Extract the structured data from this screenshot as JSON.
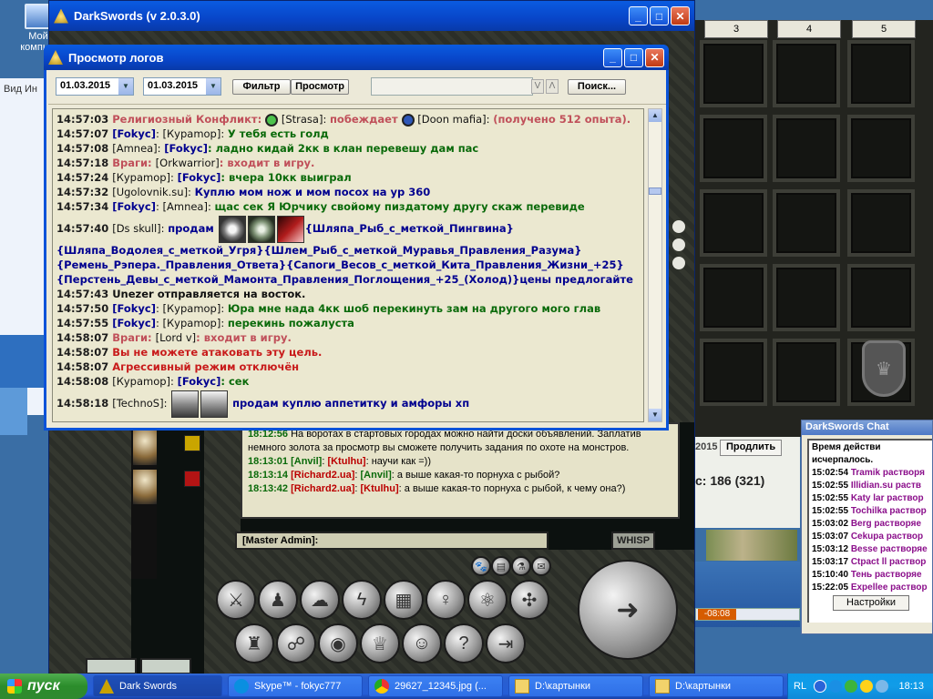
{
  "desktop": {
    "icon_label": "Мой компь...",
    "browser_menu": "Вид  Ин"
  },
  "game": {
    "title": "DarkSwords (v 2.0.3.0)",
    "chat_lines": [
      {
        "time": "18:12:56",
        "parts": [
          {
            "c": "t",
            "x": "На воротах в стартовых городах можно найти доски объявлений. Заплатив немного золота за просмотр вы сможете получить задания по охоте на монстров."
          }
        ]
      },
      {
        "time": "18:13:01",
        "parts": [
          {
            "c": "g",
            "x": "[Anvil]"
          },
          {
            "c": "t",
            "x": ": "
          },
          {
            "c": "r",
            "x": "[Ktulhu]"
          },
          {
            "c": "t",
            "x": ": научи как =))"
          }
        ]
      },
      {
        "time": "18:13:14",
        "parts": [
          {
            "c": "r",
            "x": "[Richard2.ua]"
          },
          {
            "c": "t",
            "x": ": "
          },
          {
            "c": "g",
            "x": "[Anvil]"
          },
          {
            "c": "t",
            "x": ": а выше какая-то порнуха с рыбой?"
          }
        ]
      },
      {
        "time": "18:13:42",
        "parts": [
          {
            "c": "r",
            "x": "[Richard2.ua]"
          },
          {
            "c": "t",
            "x": ": "
          },
          {
            "c": "r",
            "x": "[Ktulhu]"
          },
          {
            "c": "t",
            "x": ": а выше какая-то порнуха с рыбой, к чему она?)"
          }
        ]
      }
    ],
    "input_name": "[Master Admin]:",
    "whisp_label": "WHISP"
  },
  "inventory": {
    "headers": [
      "3",
      "4",
      "5"
    ],
    "year_fragment": "2015",
    "prolong_label": "Продлить",
    "balance": "с: 186 (321)",
    "player_time": "-08:08"
  },
  "ds_chat": {
    "title": "DarkSwords Chat",
    "lines": [
      {
        "time": "",
        "name": "",
        "text": "Время действи"
      },
      {
        "time": "",
        "name": "",
        "text": "исчерпалось."
      },
      {
        "time": "15:02:54",
        "name": "Tramik",
        "text": " растворя"
      },
      {
        "time": "15:02:55",
        "name": "Illidian.su",
        "text": " раств"
      },
      {
        "time": "15:02:55",
        "name": "Katy lar",
        "text": " раствор"
      },
      {
        "time": "15:02:55",
        "name": "Tochilka",
        "text": " раствор"
      },
      {
        "time": "15:03:02",
        "name": "Berg",
        "text": " растворяе"
      },
      {
        "time": "15:03:07",
        "name": "Cekupa",
        "text": " раствор"
      },
      {
        "time": "15:03:12",
        "name": "Besse",
        "text": " растворяе"
      },
      {
        "time": "15:03:17",
        "name": "Ctpact ll",
        "text": " раствор"
      },
      {
        "time": "15:10:40",
        "name": "Тень",
        "text": " растворяе"
      },
      {
        "time": "15:22:05",
        "name": "Expellee",
        "text": " раствор"
      }
    ],
    "settings_label": "Настройки"
  },
  "log_viewer": {
    "title": "Просмотр логов",
    "date_from": "01.03.2015",
    "date_to": "01.03.2015",
    "filter_label": "Фильтр",
    "view_label": "Просмотр",
    "search_placeholder": "",
    "search_label": "Поиск...",
    "prev_symbol": "V",
    "next_symbol": "Λ",
    "lines": [
      {
        "time": "14:57:03",
        "parts": [
          {
            "c": "msg-pk",
            "x": "Религиозный Конфликт: "
          },
          {
            "c": "icon-green",
            "x": ""
          },
          {
            "c": "nm-k",
            "x": " [Strasa]: "
          },
          {
            "c": "msg-pk",
            "x": "побеждает "
          },
          {
            "c": "icon-blue",
            "x": ""
          },
          {
            "c": "nm-k",
            "x": " [Doon mafia]: "
          },
          {
            "c": "msg-pk",
            "x": "(получено 512 опыта)."
          }
        ]
      },
      {
        "time": "14:57:07",
        "parts": [
          {
            "c": "nm-b",
            "x": "[Fokyc]"
          },
          {
            "c": "nm-k",
            "x": ": [Кураmop]: "
          },
          {
            "c": "msg-g",
            "x": "У тебя есть голд"
          }
        ]
      },
      {
        "time": "14:57:08",
        "parts": [
          {
            "c": "nm-k",
            "x": "[Amnea]: "
          },
          {
            "c": "nm-b",
            "x": "[Fokyc]"
          },
          {
            "c": "msg-g",
            "x": ": ладно кидай 2кк в клан перевешу дам пас"
          }
        ]
      },
      {
        "time": "14:57:18",
        "parts": [
          {
            "c": "msg-pk",
            "x": "Враги: "
          },
          {
            "c": "nm-k",
            "x": "[Orkwarrior]"
          },
          {
            "c": "msg-pk",
            "x": ": входит в игру."
          }
        ]
      },
      {
        "time": "14:57:24",
        "parts": [
          {
            "c": "nm-k",
            "x": "[Кураmop]: "
          },
          {
            "c": "nm-b",
            "x": "[Fokyc]"
          },
          {
            "c": "msg-g",
            "x": ": вчера 10кк выиграл"
          }
        ]
      },
      {
        "time": "14:57:32",
        "parts": [
          {
            "c": "nm-k",
            "x": "[Ugolovnik.su]: "
          },
          {
            "c": "msg-b",
            "x": "Куплю мом нож и мом посох на ур 360"
          }
        ]
      },
      {
        "time": "14:57:34",
        "parts": [
          {
            "c": "nm-b",
            "x": "[Fokyc]"
          },
          {
            "c": "nm-k",
            "x": ": [Amnea]: "
          },
          {
            "c": "msg-g",
            "x": "щас сек Я Юрчику свойому пиздатому другу   скаж перевиде"
          }
        ]
      },
      {
        "time": "14:57:40",
        "parts": [
          {
            "c": "nm-k",
            "x": "[Ds skull]: "
          },
          {
            "c": "msg-b",
            "x": "продам "
          },
          {
            "c": "item1",
            "x": ""
          },
          {
            "c": "item2",
            "x": ""
          },
          {
            "c": "item3",
            "x": ""
          },
          {
            "c": "msg-b",
            "x": "{Шляпа_Рыб_с_меткой_Пингвина}"
          }
        ]
      },
      {
        "time": "",
        "parts": [
          {
            "c": "msg-b",
            "x": "{Шляпа_Водолея_с_меткой_Угря}{Шлем_Рыб_с_меткой_Муравья_Правления_Разума}"
          }
        ]
      },
      {
        "time": "",
        "parts": [
          {
            "c": "msg-b",
            "x": "{Ремень_Рэпера._Правления_Ответа}{Сапоги_Весов_с_меткой_Кита_Правления_Жизни_+25}"
          }
        ]
      },
      {
        "time": "",
        "parts": [
          {
            "c": "msg-b",
            "x": "{Перстень_Девы_с_меткой_Мамонта_Правления_Поглощения_+25_(Холод)}цены предлогайте"
          }
        ]
      },
      {
        "time": "14:57:43",
        "parts": [
          {
            "c": "msg-k",
            "x": "Unezer отправляется на восток."
          }
        ]
      },
      {
        "time": "14:57:50",
        "parts": [
          {
            "c": "nm-b",
            "x": "[Fokyc]"
          },
          {
            "c": "nm-k",
            "x": ": [Кураmop]: "
          },
          {
            "c": "msg-g",
            "x": "Юра мне нада 4кк  шоб перекинуть зам на другого мого глав"
          }
        ]
      },
      {
        "time": "14:57:55",
        "parts": [
          {
            "c": "nm-b",
            "x": "[Fokyc]"
          },
          {
            "c": "nm-k",
            "x": ": [Кураmop]: "
          },
          {
            "c": "msg-g",
            "x": "перекинь пожалуста"
          }
        ]
      },
      {
        "time": "14:58:07",
        "parts": [
          {
            "c": "msg-pk",
            "x": "Враги: "
          },
          {
            "c": "nm-k",
            "x": "[Lord v]"
          },
          {
            "c": "msg-pk",
            "x": ": входит в игру."
          }
        ]
      },
      {
        "time": "14:58:07",
        "parts": [
          {
            "c": "msg-red",
            "x": "Вы не можете атаковать эту цель."
          }
        ]
      },
      {
        "time": "14:58:07",
        "parts": [
          {
            "c": "msg-red",
            "x": "Агрессивный режим отключён"
          }
        ]
      },
      {
        "time": "14:58:08",
        "parts": [
          {
            "c": "nm-k",
            "x": "[Кураmop]: "
          },
          {
            "c": "nm-b",
            "x": "[Fokyc]"
          },
          {
            "c": "msg-g",
            "x": ": сек"
          }
        ]
      },
      {
        "time": "14:58:18",
        "parts": [
          {
            "c": "nm-k",
            "x": "[TechnoS]: "
          },
          {
            "c": "item4",
            "x": ""
          },
          {
            "c": "item5",
            "x": ""
          },
          {
            "c": "msg-b",
            "x": "  продам  куплю аппетитку и амфоры хп"
          }
        ]
      }
    ]
  },
  "taskbar": {
    "start_label": "пуск",
    "tasks": [
      "Dark Swords",
      "Skype™ - fokyc777",
      "29627_12345.jpg (...",
      "D:\\картынки",
      "D:\\картынки"
    ],
    "lang": "RL",
    "clock": "18:13"
  },
  "colors": {
    "xp_title": "#0845c8",
    "log_bg": "#ebe8d0",
    "name_blue": "#00008f",
    "msg_green": "#0a6a0a",
    "enemy_pink": "#c0505a",
    "alert_red": "#c81b1b"
  }
}
